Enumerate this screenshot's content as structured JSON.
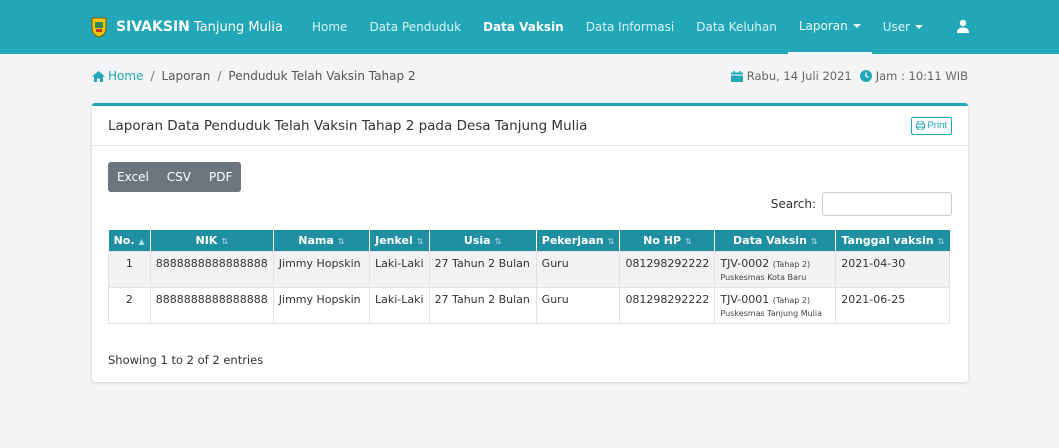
{
  "navbar": {
    "brand_name": "SIVAKSIN",
    "brand_sub": "Tanjung Mulia",
    "items": [
      {
        "label": "Home"
      },
      {
        "label": "Data Penduduk"
      },
      {
        "label": "Data Vaksin"
      },
      {
        "label": "Data Informasi"
      },
      {
        "label": "Data Keluhan"
      },
      {
        "label": "Laporan"
      },
      {
        "label": "User"
      }
    ]
  },
  "breadcrumb": {
    "home": "Home",
    "level1": "Laporan",
    "level2": "Penduduk Telah Vaksin Tahap 2"
  },
  "datetime": {
    "date": "Rabu, 14 Juli 2021",
    "time": "Jam : 10:11 WIB"
  },
  "card": {
    "title": "Laporan Data Penduduk Telah Vaksin Tahap 2 pada Desa Tanjung Mulia",
    "print_label": "Print"
  },
  "export": {
    "excel": "Excel",
    "csv": "CSV",
    "pdf": "PDF"
  },
  "search": {
    "label": "Search:",
    "value": ""
  },
  "table": {
    "headers": [
      "No.",
      "NIK",
      "Nama",
      "Jenkel",
      "Usia",
      "Pekerjaan",
      "No HP",
      "Data Vaksin",
      "Tanggal vaksin"
    ],
    "rows": [
      {
        "no": "1",
        "nik": "8888888888888888",
        "nama": "Jimmy Hopskin",
        "jenkel": "Laki-Laki",
        "usia": "27 Tahun 2 Bulan",
        "pekerjaan": "Guru",
        "nohp": "081298292222",
        "vaksin_code": "TJV-0002",
        "vaksin_tahap": "(Tahap 2)",
        "vaksin_lokasi": "Puskesmas Kota Baru",
        "tanggal": "2021-04-30"
      },
      {
        "no": "2",
        "nik": "8888888888888888",
        "nama": "Jimmy Hopskin",
        "jenkel": "Laki-Laki",
        "usia": "27 Tahun 2 Bulan",
        "pekerjaan": "Guru",
        "nohp": "081298292222",
        "vaksin_code": "TJV-0001",
        "vaksin_tahap": "(Tahap 2)",
        "vaksin_lokasi": "Puskesmas Tanjung Mulia",
        "tanggal": "2021-06-25"
      }
    ]
  },
  "footer": {
    "showing": "Showing 1 to 2 of 2 entries"
  },
  "colors": {
    "navbar": "#22a7b8",
    "table_header": "#1f8fa1",
    "export_buttons": "#6c757d"
  }
}
